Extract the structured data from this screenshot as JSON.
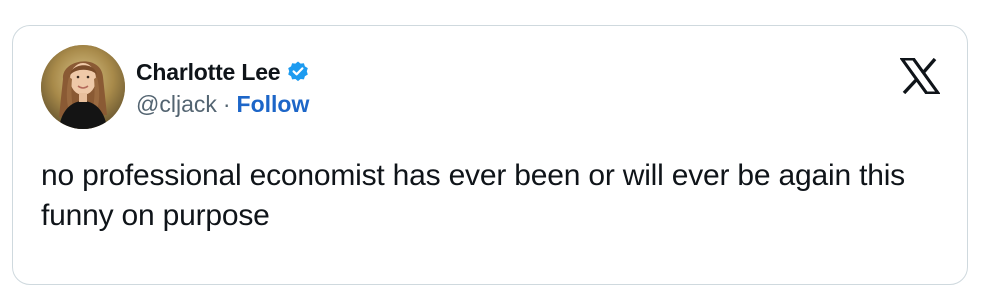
{
  "author": {
    "display_name": "Charlotte Lee",
    "handle": "@cljack",
    "separator": "·",
    "follow_label": "Follow",
    "verified": true
  },
  "icons": {
    "verified": "verified-badge-icon",
    "brand": "x-logo-icon"
  },
  "tweet": {
    "text": "no professional economist has ever been or will ever be again this funny on purpose"
  },
  "colors": {
    "verified_badge": "#1d9bf0",
    "follow_link": "#1d66c8",
    "handle": "#536471",
    "card_border": "#cfd9de",
    "text": "#0f1419"
  }
}
